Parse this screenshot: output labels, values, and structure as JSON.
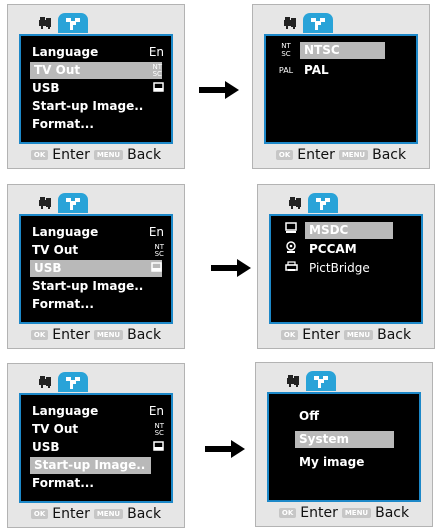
{
  "menu_items": [
    "Language",
    "TV Out",
    "USB",
    "Start-up Image..",
    "Format..."
  ],
  "language_value": "En",
  "tvout_value_top": "NT",
  "tvout_value_bottom": "SC",
  "usb_value_icon": "card-icon",
  "footer": {
    "ok_badge": "OK",
    "enter_label": "Enter",
    "menu_badge": "MENU",
    "back_label": "Back"
  },
  "tv_out_options": [
    {
      "icon_top": "NT",
      "icon_bottom": "SC",
      "label": "NTSC"
    },
    {
      "icon": "PAL",
      "label": "PAL"
    }
  ],
  "usb_options": [
    {
      "icon": "monitor-icon",
      "label": "MSDC"
    },
    {
      "icon": "webcam-icon",
      "label": "PCCAM"
    },
    {
      "icon": "printer-icon",
      "label": "PictBridge"
    }
  ],
  "startup_options": [
    "Off",
    "System",
    "My image"
  ],
  "colors": {
    "accent": "#29a3d8",
    "screen_border": "#1d88c8",
    "selection": "#b9b9b9",
    "panel": "#e6e6e6"
  }
}
